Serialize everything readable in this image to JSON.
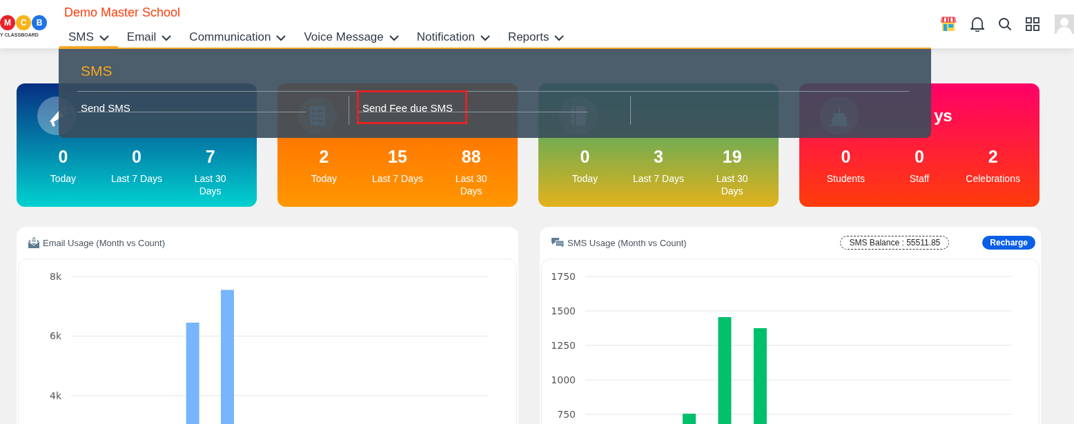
{
  "header": {
    "logo": {
      "letters": [
        "M",
        "C",
        "B"
      ],
      "text": "Y CLASSBOARD"
    },
    "school_name": "Demo Master School",
    "nav": [
      {
        "label": "SMS",
        "selected": true
      },
      {
        "label": "Email",
        "selected": false
      },
      {
        "label": "Communication",
        "selected": false
      },
      {
        "label": "Voice Message",
        "selected": false
      },
      {
        "label": "Notification",
        "selected": false
      },
      {
        "label": "Reports",
        "selected": false
      }
    ]
  },
  "dropdown": {
    "title": "SMS",
    "items": [
      {
        "label": "Send SMS",
        "highlighted": false
      },
      {
        "label": "Send Fee due SMS",
        "highlighted": true
      }
    ]
  },
  "stat_cards": [
    {
      "kind": "announcements",
      "stats": [
        {
          "value": "0",
          "label": "Today"
        },
        {
          "value": "0",
          "label": "Last 7 Days"
        },
        {
          "value": "7",
          "label": "Last 30 Days"
        }
      ]
    },
    {
      "kind": "assignments",
      "stats": [
        {
          "value": "2",
          "label": "Today"
        },
        {
          "value": "15",
          "label": "Last 7 Days"
        },
        {
          "value": "88",
          "label": "Last 30 Days"
        }
      ]
    },
    {
      "kind": "diary",
      "stats": [
        {
          "value": "0",
          "label": "Today"
        },
        {
          "value": "3",
          "label": "Last 7 Days"
        },
        {
          "value": "19",
          "label": "Last 30 Days"
        }
      ]
    },
    {
      "kind": "birthdays",
      "title": "ys",
      "stats": [
        {
          "value": "0",
          "label": "Students"
        },
        {
          "value": "0",
          "label": "Staff"
        },
        {
          "value": "2",
          "label": "Celebrations"
        }
      ]
    }
  ],
  "charts": [
    {
      "kind": "email",
      "title": "Email Usage (Month vs Count)",
      "chart_data": {
        "type": "bar",
        "grid": true,
        "ylim": [
          3000,
          8000
        ],
        "yticks": [
          {
            "value": 8000,
            "label": "8k"
          },
          {
            "value": 6000,
            "label": "6k"
          },
          {
            "value": 4000,
            "label": "4k"
          }
        ],
        "series": [
          {
            "color": "#77b5fe",
            "values": [
              null,
              null,
              null,
              6450,
              7550,
              null,
              null,
              null,
              null,
              null,
              null,
              null
            ]
          }
        ]
      }
    },
    {
      "kind": "sms",
      "title": "SMS Usage (Month vs Count)",
      "balance": "SMS Balance : 55511.85",
      "action": "Recharge",
      "chart_data": {
        "type": "bar",
        "grid": true,
        "ylim": [
          670,
          1750
        ],
        "yticks": [
          1750,
          1500,
          1250,
          1000,
          750
        ],
        "series": [
          {
            "color": "#00c06b",
            "values": [
              null,
              null,
              755,
              1455,
              1375,
              null,
              null,
              null,
              null,
              null,
              null,
              null
            ]
          }
        ]
      }
    }
  ]
}
